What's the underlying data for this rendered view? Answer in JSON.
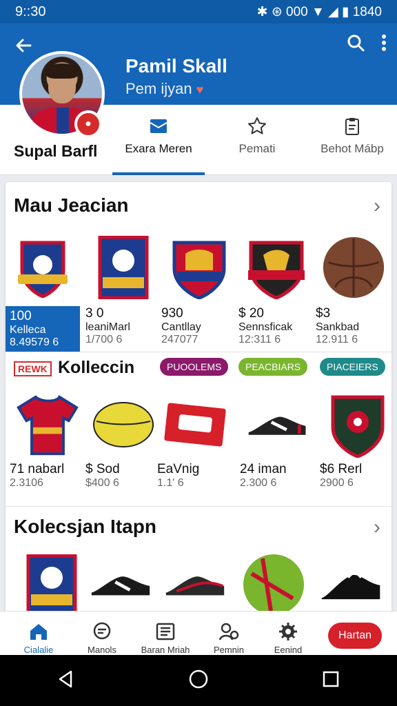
{
  "status": {
    "time": "9::30",
    "right": "✱ ⊛ 000 ▼ ◢ ▮ 1840"
  },
  "header": {
    "name": "Pamil Skall",
    "subtitle": "Pem ijyan"
  },
  "profile": {
    "display_name": "Supal Barfl"
  },
  "tabs": [
    {
      "label": "Exara Meren",
      "icon": "inbox-icon"
    },
    {
      "label": "Pemati",
      "icon": "star-icon"
    },
    {
      "label": "Behot Mábp",
      "icon": "clipboard-icon"
    }
  ],
  "section1": {
    "title": "Mau Jeacian",
    "items": [
      {
        "v1": "100",
        "v2": "Kelleca",
        "v3": "8.49579 6"
      },
      {
        "v1": "3 0",
        "v2": "leaniMarl",
        "v3": "1/700 6"
      },
      {
        "v1": "930",
        "v2": "Cantllay",
        "v3": "247077"
      },
      {
        "v1": "$ 20",
        "v2": "Sennsficak",
        "v3": "12:311 6"
      },
      {
        "v1": "$3",
        "v2": "Sankbad",
        "v3": "12.911 6"
      }
    ]
  },
  "section2": {
    "tag": "REWK",
    "title": "Kolleccin",
    "chips": [
      {
        "label": "PUOOLEMS",
        "color": "#8b1a6b"
      },
      {
        "label": "PEACBIARS",
        "color": "#7ab52e"
      },
      {
        "label": "PIACEIERS",
        "color": "#1f8a8a"
      }
    ],
    "items": [
      {
        "v1": "71 nabarl",
        "v3": "2.3106"
      },
      {
        "v1": "$ Sod",
        "v3": "$400 6"
      },
      {
        "v1": "EaVnig",
        "v3": "1.1' 6"
      },
      {
        "v1": "24 iman",
        "v3": "2.300 6"
      },
      {
        "v1": "$6 Rerl",
        "v3": "2900 6"
      }
    ]
  },
  "section3": {
    "title": "Kolecsjan Itapn"
  },
  "bottom_nav": [
    {
      "label": "Cialalie",
      "icon": "home-icon"
    },
    {
      "label": "Manols",
      "icon": "chat-icon"
    },
    {
      "label": "Baran Mriah",
      "icon": "list-icon"
    },
    {
      "label": "Pemnin",
      "icon": "people-icon"
    },
    {
      "label": "Eenind",
      "icon": "gear-icon"
    }
  ],
  "cta": {
    "label": "Hartan"
  },
  "colors": {
    "primary": "#1565b8",
    "status": "#0f5ba6",
    "accent": "#d6202a"
  }
}
